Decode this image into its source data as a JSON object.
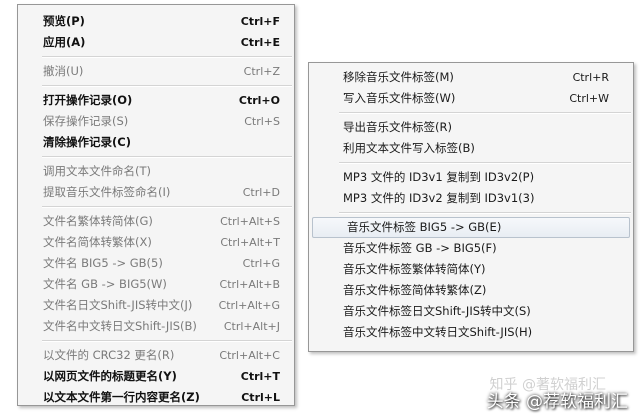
{
  "left_menu": {
    "items": [
      {
        "label": "预览(P)",
        "shortcut": "Ctrl+F",
        "disabled": false,
        "bold": true
      },
      {
        "label": "应用(A)",
        "shortcut": "Ctrl+E",
        "disabled": false,
        "bold": true
      },
      {
        "sep": true
      },
      {
        "label": "撤消(U)",
        "shortcut": "Ctrl+Z",
        "disabled": true,
        "bold": false
      },
      {
        "sep": true
      },
      {
        "label": "打开操作记录(O)",
        "shortcut": "Ctrl+O",
        "disabled": false,
        "bold": true
      },
      {
        "label": "保存操作记录(S)",
        "shortcut": "Ctrl+S",
        "disabled": true,
        "bold": false
      },
      {
        "label": "清除操作记录(C)",
        "shortcut": "",
        "disabled": false,
        "bold": true
      },
      {
        "sep": true
      },
      {
        "label": "调用文本文件命名(T)",
        "shortcut": "",
        "disabled": true,
        "bold": false
      },
      {
        "label": "提取音乐文件标签命名(I)",
        "shortcut": "Ctrl+D",
        "disabled": true,
        "bold": false
      },
      {
        "sep": true
      },
      {
        "label": "文件名繁体转简体(G)",
        "shortcut": "Ctrl+Alt+S",
        "disabled": true,
        "bold": false
      },
      {
        "label": "文件名简体转繁体(X)",
        "shortcut": "Ctrl+Alt+T",
        "disabled": true,
        "bold": false
      },
      {
        "label": "文件名 BIG5 -> GB(5)",
        "shortcut": "Ctrl+G",
        "disabled": true,
        "bold": false
      },
      {
        "label": "文件名 GB -> BIG5(W)",
        "shortcut": "Ctrl+Alt+B",
        "disabled": true,
        "bold": false
      },
      {
        "label": "文件名日文Shift-JIS转中文(J)",
        "shortcut": "Ctrl+Alt+G",
        "disabled": true,
        "bold": false
      },
      {
        "label": "文件名中文转日文Shift-JIS(B)",
        "shortcut": "Ctrl+Alt+J",
        "disabled": true,
        "bold": false
      },
      {
        "sep": true
      },
      {
        "label": "以文件的 CRC32 更名(R)",
        "shortcut": "Ctrl+Alt+C",
        "disabled": true,
        "bold": false
      },
      {
        "label": "以网页文件的标题更名(Y)",
        "shortcut": "Ctrl+T",
        "disabled": false,
        "bold": true
      },
      {
        "label": "以文本文件第一行内容更名(Z)",
        "shortcut": "Ctrl+L",
        "disabled": false,
        "bold": true
      }
    ]
  },
  "right_menu": {
    "items": [
      {
        "label": "移除音乐文件标签(M)",
        "shortcut": "Ctrl+R",
        "disabled": false
      },
      {
        "label": "写入音乐文件标签(W)",
        "shortcut": "Ctrl+W",
        "disabled": false
      },
      {
        "sep": true
      },
      {
        "label": "导出音乐文件标签(R)",
        "shortcut": "",
        "disabled": false
      },
      {
        "label": "利用文本文件写入标签(B)",
        "shortcut": "",
        "disabled": false
      },
      {
        "sep": true
      },
      {
        "label": "MP3 文件的 ID3v1 复制到 ID3v2(P)",
        "shortcut": "",
        "disabled": false
      },
      {
        "label": "MP3 文件的 ID3v2 复制到 ID3v1(3)",
        "shortcut": "",
        "disabled": false
      },
      {
        "sep": true
      },
      {
        "label": "音乐文件标签 BIG5 -> GB(E)",
        "shortcut": "",
        "disabled": false,
        "highlighted": true
      },
      {
        "label": "音乐文件标签 GB -> BIG5(F)",
        "shortcut": "",
        "disabled": false
      },
      {
        "label": "音乐文件标签繁体转简体(Y)",
        "shortcut": "",
        "disabled": false
      },
      {
        "label": "音乐文件标签简体转繁体(Z)",
        "shortcut": "",
        "disabled": false
      },
      {
        "label": "音乐文件标签日文Shift-JIS转中文(S)",
        "shortcut": "",
        "disabled": false
      },
      {
        "label": "音乐文件标签中文转日文Shift-JIS(H)",
        "shortcut": "",
        "disabled": false
      }
    ]
  },
  "watermark": {
    "faint": "知乎 @著软福利汇",
    "text": "头条 @荐软福利汇"
  }
}
